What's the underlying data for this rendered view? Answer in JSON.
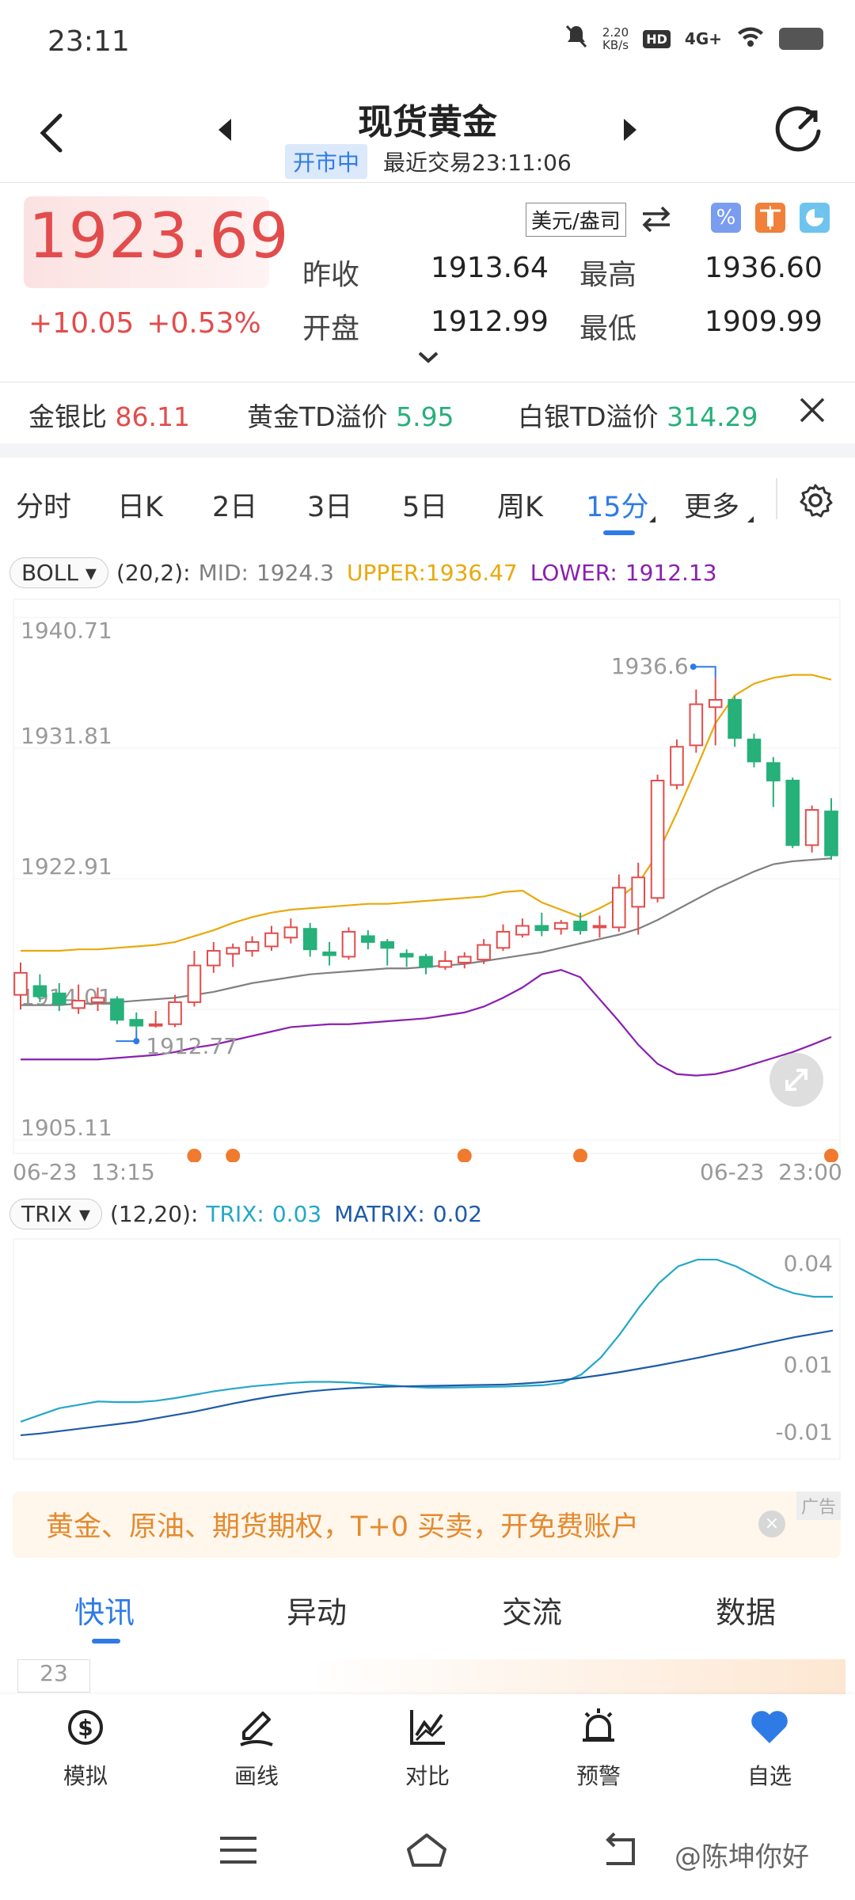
{
  "status_bar": {
    "time": "23:11",
    "net_speed_value": "2.20",
    "net_speed_unit": "KB/s",
    "hd": "HD",
    "network": "4G+"
  },
  "header": {
    "title": "现货黄金",
    "market_status": "开市中",
    "last_trade": "最近交易23:11:06"
  },
  "quote": {
    "price": "1923.69",
    "change": "+10.05",
    "change_pct": "+0.53%",
    "unit": "美元/盎司",
    "prev_close_label": "昨收",
    "prev_close": "1913.64",
    "high_label": "最高",
    "high": "1936.60",
    "open_label": "开盘",
    "open": "1912.99",
    "low_label": "最低",
    "low": "1909.99"
  },
  "ratios": {
    "gold_silver_label": "金银比",
    "gold_silver": "86.11",
    "gold_td_label": "黄金TD溢价",
    "gold_td": "5.95",
    "silver_td_label": "白银TD溢价",
    "silver_td": "314.29"
  },
  "tabs": [
    "分时",
    "日K",
    "2日",
    "3日",
    "5日",
    "周K",
    "15分",
    "更多"
  ],
  "active_tab": "15分",
  "boll": {
    "name": "BOLL",
    "params": "(20,2):",
    "mid_label": "MID:",
    "mid": "1924.3",
    "upper_label": "UPPER:",
    "upper": "1936.47",
    "lower_label": "LOWER:",
    "lower": "1912.13"
  },
  "trix": {
    "name": "TRIX",
    "params": "(12,20):",
    "trix_label": "TRIX:",
    "trix": "0.03",
    "matrix_label": "MATRIX:",
    "matrix": "0.02"
  },
  "chart_data": [
    {
      "type": "candlestick",
      "y_ticks": [
        "1940.71",
        "1931.81",
        "1922.91",
        "1914.01",
        "1905.11"
      ],
      "ylim": [
        1905.11,
        1940.71
      ],
      "x_start_label": "06-23  13:15",
      "x_end_label": "06-23  23:00",
      "max_marker": "1936.6",
      "min_marker": "1912.77",
      "candles": [
        {
          "o": 1915.0,
          "c": 1916.5,
          "h": 1917.2,
          "l": 1914.0
        },
        {
          "o": 1915.6,
          "c": 1914.9,
          "h": 1916.4,
          "l": 1914.5
        },
        {
          "o": 1915.1,
          "c": 1914.4,
          "h": 1915.8,
          "l": 1913.9
        },
        {
          "o": 1914.1,
          "c": 1914.6,
          "h": 1915.7,
          "l": 1913.7
        },
        {
          "o": 1914.5,
          "c": 1914.8,
          "h": 1915.5,
          "l": 1913.9
        },
        {
          "o": 1914.7,
          "c": 1913.3,
          "h": 1914.9,
          "l": 1913.0
        },
        {
          "o": 1913.3,
          "c": 1912.9,
          "h": 1913.8,
          "l": 1912.6
        },
        {
          "o": 1912.9,
          "c": 1913.0,
          "h": 1913.9,
          "l": 1912.77
        },
        {
          "o": 1913.0,
          "c": 1914.5,
          "h": 1915.0,
          "l": 1912.8
        },
        {
          "o": 1914.5,
          "c": 1917.0,
          "h": 1918.0,
          "l": 1914.2
        },
        {
          "o": 1917.0,
          "c": 1918.0,
          "h": 1918.6,
          "l": 1916.5
        },
        {
          "o": 1917.8,
          "c": 1918.2,
          "h": 1918.5,
          "l": 1916.9
        },
        {
          "o": 1918.0,
          "c": 1918.6,
          "h": 1919.0,
          "l": 1917.6
        },
        {
          "o": 1918.3,
          "c": 1919.2,
          "h": 1919.7,
          "l": 1918.0
        },
        {
          "o": 1918.9,
          "c": 1919.6,
          "h": 1920.2,
          "l": 1918.5
        },
        {
          "o": 1919.5,
          "c": 1918.1,
          "h": 1919.9,
          "l": 1917.6
        },
        {
          "o": 1917.9,
          "c": 1917.7,
          "h": 1918.6,
          "l": 1917.0
        },
        {
          "o": 1917.6,
          "c": 1919.3,
          "h": 1919.6,
          "l": 1917.4
        },
        {
          "o": 1919.0,
          "c": 1918.6,
          "h": 1919.4,
          "l": 1918.1
        },
        {
          "o": 1918.6,
          "c": 1918.2,
          "h": 1918.8,
          "l": 1917.0
        },
        {
          "o": 1917.8,
          "c": 1917.6,
          "h": 1918.1,
          "l": 1916.9
        },
        {
          "o": 1917.6,
          "c": 1916.9,
          "h": 1917.8,
          "l": 1916.4
        },
        {
          "o": 1916.9,
          "c": 1917.3,
          "h": 1918.0,
          "l": 1916.7
        },
        {
          "o": 1917.2,
          "c": 1917.6,
          "h": 1917.9,
          "l": 1916.8
        },
        {
          "o": 1917.4,
          "c": 1918.4,
          "h": 1918.8,
          "l": 1917.1
        },
        {
          "o": 1918.2,
          "c": 1919.3,
          "h": 1919.8,
          "l": 1918.0
        },
        {
          "o": 1919.1,
          "c": 1919.7,
          "h": 1920.2,
          "l": 1918.9
        },
        {
          "o": 1919.7,
          "c": 1919.4,
          "h": 1920.6,
          "l": 1919.0
        },
        {
          "o": 1919.5,
          "c": 1919.9,
          "h": 1920.1,
          "l": 1919.1
        },
        {
          "o": 1920.0,
          "c": 1919.4,
          "h": 1920.6,
          "l": 1919.1
        },
        {
          "o": 1919.6,
          "c": 1919.7,
          "h": 1920.4,
          "l": 1918.9
        },
        {
          "o": 1919.6,
          "c": 1922.3,
          "h": 1923.2,
          "l": 1919.3
        },
        {
          "o": 1921.0,
          "c": 1923.0,
          "h": 1924.0,
          "l": 1919.1
        },
        {
          "o": 1921.6,
          "c": 1929.6,
          "h": 1930.0,
          "l": 1921.3
        },
        {
          "o": 1929.3,
          "c": 1931.9,
          "h": 1932.4,
          "l": 1929.0
        },
        {
          "o": 1932.0,
          "c": 1934.8,
          "h": 1935.8,
          "l": 1931.5
        },
        {
          "o": 1934.6,
          "c": 1935.1,
          "h": 1936.6,
          "l": 1932.0
        },
        {
          "o": 1935.1,
          "c": 1932.5,
          "h": 1935.4,
          "l": 1931.9
        },
        {
          "o": 1932.4,
          "c": 1930.9,
          "h": 1932.8,
          "l": 1930.5
        },
        {
          "o": 1930.8,
          "c": 1929.6,
          "h": 1931.2,
          "l": 1927.8
        },
        {
          "o": 1929.6,
          "c": 1925.2,
          "h": 1929.8,
          "l": 1925.0
        },
        {
          "o": 1925.2,
          "c": 1927.6,
          "h": 1927.9,
          "l": 1924.7
        },
        {
          "o": 1927.5,
          "c": 1924.5,
          "h": 1928.4,
          "l": 1924.2
        }
      ],
      "upper": [
        1918.0,
        1918.0,
        1918.0,
        1918.1,
        1918.1,
        1918.2,
        1918.3,
        1918.4,
        1918.6,
        1919.0,
        1919.4,
        1919.9,
        1920.3,
        1920.6,
        1920.8,
        1920.9,
        1921.0,
        1921.1,
        1921.2,
        1921.2,
        1921.3,
        1921.4,
        1921.5,
        1921.6,
        1921.7,
        1922.0,
        1922.1,
        1921.3,
        1920.8,
        1920.3,
        1920.9,
        1921.6,
        1922.6,
        1924.6,
        1927.4,
        1930.4,
        1933.5,
        1935.4,
        1936.2,
        1936.6,
        1936.8,
        1936.8,
        1936.47
      ],
      "mid": [
        1914.3,
        1914.3,
        1914.3,
        1914.4,
        1914.4,
        1914.5,
        1914.6,
        1914.7,
        1914.8,
        1915.0,
        1915.2,
        1915.5,
        1915.8,
        1916.0,
        1916.2,
        1916.4,
        1916.5,
        1916.6,
        1916.7,
        1916.8,
        1916.8,
        1916.9,
        1917.0,
        1917.1,
        1917.3,
        1917.5,
        1917.7,
        1917.9,
        1918.2,
        1918.5,
        1918.8,
        1919.1,
        1919.5,
        1920.1,
        1920.8,
        1921.5,
        1922.2,
        1922.8,
        1923.4,
        1923.9,
        1924.1,
        1924.2,
        1924.3
      ],
      "lower": [
        1910.6,
        1910.6,
        1910.6,
        1910.6,
        1910.6,
        1910.7,
        1910.8,
        1910.9,
        1911.1,
        1911.4,
        1911.6,
        1911.9,
        1912.2,
        1912.5,
        1912.8,
        1912.9,
        1913.0,
        1913.0,
        1913.1,
        1913.2,
        1913.3,
        1913.4,
        1913.6,
        1913.8,
        1914.2,
        1914.8,
        1915.5,
        1916.4,
        1916.7,
        1916.2,
        1914.7,
        1913.2,
        1911.6,
        1910.3,
        1909.6,
        1909.5,
        1909.6,
        1909.9,
        1910.3,
        1910.7,
        1911.1,
        1911.6,
        1912.13
      ],
      "markers": [
        9,
        11,
        23,
        29,
        42
      ]
    },
    {
      "type": "line",
      "y_ticks": [
        "0.04",
        "0.01",
        "-0.01"
      ],
      "ylim": [
        -0.015,
        0.045
      ],
      "series": [
        {
          "name": "TRIX",
          "values": [
            -0.007,
            -0.005,
            -0.003,
            -0.002,
            -0.001,
            -0.0012,
            -0.0012,
            -0.0008,
            0.0,
            0.001,
            0.002,
            0.0028,
            0.0035,
            0.004,
            0.0045,
            0.0048,
            0.0048,
            0.0046,
            0.0042,
            0.0038,
            0.0034,
            0.0031,
            0.0031,
            0.0032,
            0.0033,
            0.0034,
            0.0036,
            0.0038,
            0.0045,
            0.007,
            0.012,
            0.019,
            0.027,
            0.034,
            0.039,
            0.041,
            0.041,
            0.039,
            0.036,
            0.033,
            0.031,
            0.03,
            0.03
          ]
        },
        {
          "name": "MATRIX",
          "values": [
            -0.011,
            -0.0105,
            -0.0098,
            -0.0091,
            -0.0084,
            -0.0077,
            -0.007,
            -0.006,
            -0.005,
            -0.004,
            -0.0028,
            -0.0016,
            -0.0005,
            0.0005,
            0.0013,
            0.002,
            0.0025,
            0.0029,
            0.0032,
            0.0034,
            0.0035,
            0.0036,
            0.0037,
            0.0038,
            0.0039,
            0.004,
            0.0043,
            0.0047,
            0.0053,
            0.006,
            0.0068,
            0.0077,
            0.0087,
            0.0097,
            0.0108,
            0.0119,
            0.0131,
            0.0143,
            0.0156,
            0.0168,
            0.018,
            0.019,
            0.02
          ]
        }
      ]
    }
  ],
  "ad": {
    "text": "黄金、原油、期货期权，T+0  买卖，开免费账户",
    "tag": "广告",
    "close": "×"
  },
  "news_tabs": [
    "快讯",
    "异动",
    "交流",
    "数据"
  ],
  "news_peek": {
    "date": "23"
  },
  "bottom_nav": [
    {
      "label": "模拟",
      "icon": "simulate-icon"
    },
    {
      "label": "画线",
      "icon": "draw-line-icon"
    },
    {
      "label": "对比",
      "icon": "compare-icon"
    },
    {
      "label": "预警",
      "icon": "alert-bell-icon"
    },
    {
      "label": "自选",
      "icon": "favorite-heart-icon"
    }
  ],
  "watermark": "@陈坤你好",
  "colors": {
    "up": "#e34c4c",
    "down": "#26b07a",
    "accent": "#2f7be6",
    "upper": "#e8a90c",
    "mid": "#808080",
    "lower": "#8a1fb0",
    "trix": "#24a7c9",
    "matrix": "#1e5ba8",
    "ad": "#e58a2e"
  }
}
